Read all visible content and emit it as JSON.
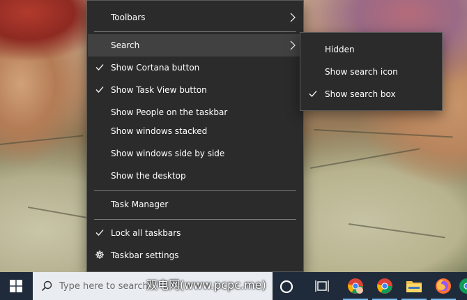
{
  "context_menu": {
    "items": [
      {
        "label": "Toolbars",
        "checked": false,
        "has_submenu": true,
        "icon": null
      },
      {
        "label": "Search",
        "checked": false,
        "has_submenu": true,
        "icon": null,
        "active": true
      },
      {
        "label": "Show Cortana button",
        "checked": true,
        "has_submenu": false,
        "icon": null
      },
      {
        "label": "Show Task View button",
        "checked": true,
        "has_submenu": false,
        "icon": null
      },
      {
        "label": "Show People on the taskbar",
        "checked": false,
        "has_submenu": false,
        "icon": null
      },
      {
        "label": "Show windows stacked",
        "checked": false,
        "has_submenu": false,
        "icon": null
      },
      {
        "label": "Show windows side by side",
        "checked": false,
        "has_submenu": false,
        "icon": null
      },
      {
        "label": "Show the desktop",
        "checked": false,
        "has_submenu": false,
        "icon": null
      },
      {
        "label": "Task Manager",
        "checked": false,
        "has_submenu": false,
        "icon": null
      },
      {
        "label": "Lock all taskbars",
        "checked": true,
        "has_submenu": false,
        "icon": null
      },
      {
        "label": "Taskbar settings",
        "checked": false,
        "has_submenu": false,
        "icon": "gear-icon"
      }
    ]
  },
  "search_submenu": {
    "items": [
      {
        "label": "Hidden",
        "checked": false
      },
      {
        "label": "Show search icon",
        "checked": false
      },
      {
        "label": "Show search box",
        "checked": true
      }
    ]
  },
  "taskbar": {
    "start_icon": "windows-logo-icon",
    "search_placeholder": "Type here to search",
    "watermark": "双电网(www.pcpc.me)",
    "cortana_icon": "cortana-ring-icon",
    "taskview_icon": "task-view-icon",
    "apps": [
      {
        "name": "chrome-user",
        "icon": "chrome-profile-icon"
      },
      {
        "name": "chrome",
        "icon": "chrome-icon"
      },
      {
        "name": "file-explorer",
        "icon": "folder-icon"
      },
      {
        "name": "firefox",
        "icon": "firefox-icon"
      },
      {
        "name": "chrome-partial",
        "icon": "chrome-icon"
      }
    ]
  },
  "colors": {
    "menu_bg": "#2b2b2b",
    "menu_hover": "#414141",
    "menu_text": "#ffffff",
    "taskbar_bg": "#1f2b3a",
    "search_bg": "#e9edf1"
  }
}
